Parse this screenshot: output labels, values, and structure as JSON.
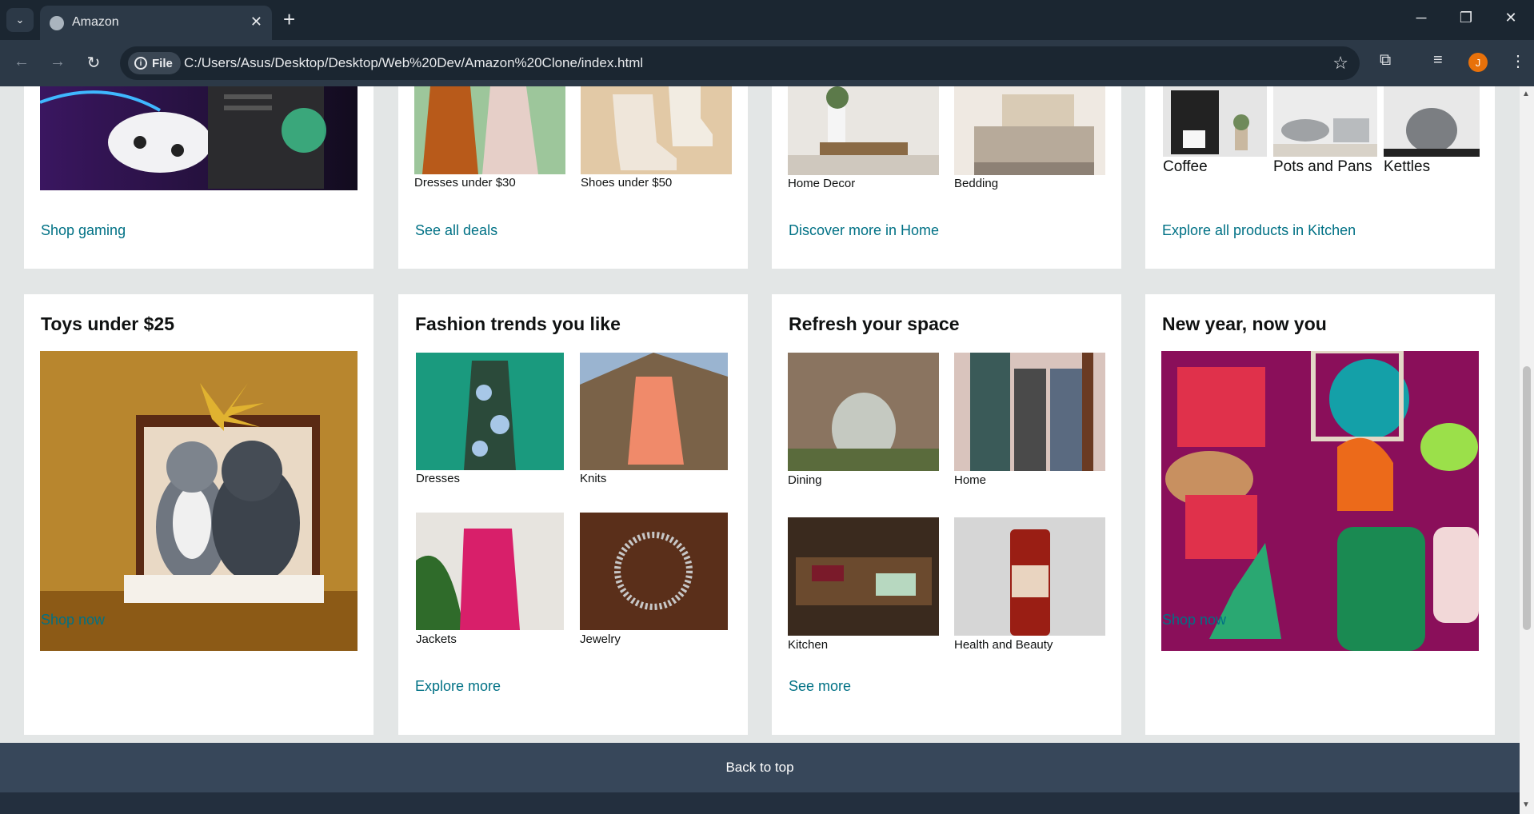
{
  "browser": {
    "tab_title": "Amazon",
    "file_chip": "File",
    "url": "C:/Users/Asus/Desktop/Desktop/Web%20Dev/Amazon%20Clone/index.html",
    "profile_initial": "J"
  },
  "top_row": [
    {
      "link": "Shop gaming"
    },
    {
      "labels": [
        "Dresses under $30",
        "Shoes under $50"
      ],
      "link": "See all deals"
    },
    {
      "labels": [
        "Home Decor",
        "Bedding"
      ],
      "link": "Discover more in Home"
    },
    {
      "labels": [
        "Coffee",
        "Pots and Pans",
        "Kettles"
      ],
      "link": "Explore all products in Kitchen"
    }
  ],
  "cards": [
    {
      "title": "Toys under $25",
      "link": "Shop now"
    },
    {
      "title": "Fashion trends you like",
      "labels": [
        "Dresses",
        "Knits",
        "Jackets",
        "Jewelry"
      ],
      "link": "Explore more"
    },
    {
      "title": "Refresh your space",
      "labels": [
        "Dining",
        "Home",
        "Kitchen",
        "Health and Beauty"
      ],
      "link": "See more"
    },
    {
      "title": "New year, now you",
      "link": "Shop now"
    }
  ],
  "footer": {
    "back_to_top": "Back to top"
  },
  "colors": {
    "link": "#007185",
    "page_bg": "#e3e6e6",
    "back_to_top_bg": "#37475a"
  }
}
